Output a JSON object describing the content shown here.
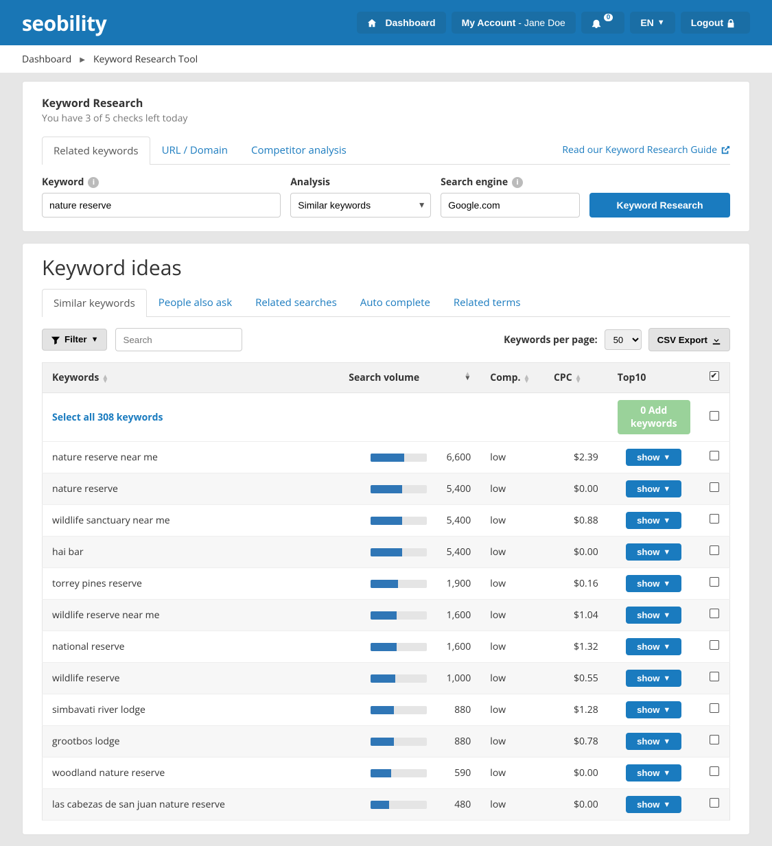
{
  "header": {
    "logo": "seobility",
    "dashboard": "Dashboard",
    "account_label": "My Account",
    "account_user": "Jane Doe",
    "notif_count": "0",
    "lang": "EN",
    "logout": "Logout"
  },
  "breadcrumb": {
    "root": "Dashboard",
    "current": "Keyword Research Tool"
  },
  "research_panel": {
    "title": "Keyword Research",
    "sub": "You have 3 of 5 checks left today",
    "tabs": {
      "related": "Related keywords",
      "url": "URL / Domain",
      "competitor": "Competitor analysis"
    },
    "guide": "Read our Keyword Research Guide",
    "keyword_label": "Keyword",
    "keyword_value": "nature reserve",
    "analysis_label": "Analysis",
    "analysis_value": "Similar keywords",
    "engine_label": "Search engine",
    "engine_value": "Google.com",
    "submit": "Keyword Research"
  },
  "ideas": {
    "heading": "Keyword ideas",
    "tabs": {
      "similar": "Similar keywords",
      "also_ask": "People also ask",
      "related_searches": "Related searches",
      "autocomplete": "Auto complete",
      "related_terms": "Related terms"
    },
    "filter": "Filter",
    "search_placeholder": "Search",
    "kpp_label": "Keywords per page:",
    "kpp_value": "50",
    "csv": "CSV Export",
    "cols": {
      "keywords": "Keywords",
      "volume": "Search volume",
      "comp": "Comp.",
      "cpc": "CPC",
      "top10": "Top10"
    },
    "select_all": "Select all 308 keywords",
    "add_keywords": "0 Add keywords",
    "show_label": "show",
    "rows": [
      {
        "kw": "nature reserve near me",
        "vol": "6,600",
        "bar": 60,
        "comp": "low",
        "cpc": "$2.39"
      },
      {
        "kw": "nature reserve",
        "vol": "5,400",
        "bar": 56,
        "comp": "low",
        "cpc": "$0.00"
      },
      {
        "kw": "wildlife sanctuary near me",
        "vol": "5,400",
        "bar": 56,
        "comp": "low",
        "cpc": "$0.88"
      },
      {
        "kw": "hai bar",
        "vol": "5,400",
        "bar": 56,
        "comp": "low",
        "cpc": "$0.00"
      },
      {
        "kw": "torrey pines reserve",
        "vol": "1,900",
        "bar": 48,
        "comp": "low",
        "cpc": "$0.16"
      },
      {
        "kw": "wildlife reserve near me",
        "vol": "1,600",
        "bar": 46,
        "comp": "low",
        "cpc": "$1.04"
      },
      {
        "kw": "national reserve",
        "vol": "1,600",
        "bar": 46,
        "comp": "low",
        "cpc": "$1.32"
      },
      {
        "kw": "wildlife reserve",
        "vol": "1,000",
        "bar": 43,
        "comp": "low",
        "cpc": "$0.55"
      },
      {
        "kw": "simbavati river lodge",
        "vol": "880",
        "bar": 41,
        "comp": "low",
        "cpc": "$1.28"
      },
      {
        "kw": "grootbos lodge",
        "vol": "880",
        "bar": 41,
        "comp": "low",
        "cpc": "$0.78"
      },
      {
        "kw": "woodland nature reserve",
        "vol": "590",
        "bar": 36,
        "comp": "low",
        "cpc": "$0.00"
      },
      {
        "kw": "las cabezas de san juan nature reserve",
        "vol": "480",
        "bar": 33,
        "comp": "low",
        "cpc": "$0.00"
      }
    ]
  }
}
